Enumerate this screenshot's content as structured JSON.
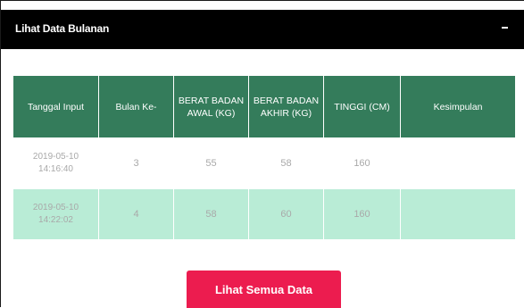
{
  "panel": {
    "title": "Lihat Data Bulanan"
  },
  "table": {
    "headers": [
      "Tanggal Input",
      "Bulan Ke-",
      "BERAT BADAN AWAL (KG)",
      "BERAT BADAN AKHIR (KG)",
      "TINGGI (CM)",
      "Kesimpulan"
    ],
    "rows": [
      {
        "date": "2019-05-10",
        "time": "14:16:40",
        "month": "3",
        "weight_start": "55",
        "weight_end": "58",
        "height": "160",
        "conclusion": ""
      },
      {
        "date": "2019-05-10",
        "time": "14:22:02",
        "month": "4",
        "weight_start": "58",
        "weight_end": "60",
        "height": "160",
        "conclusion": ""
      }
    ]
  },
  "actions": {
    "view_all_label": "Lihat Semua Data"
  },
  "colors": {
    "header_bg": "#000000",
    "table_header_bg": "#347c5b",
    "row_alt_bg": "#b9ecd6",
    "button_bg": "#ec1c4f"
  }
}
